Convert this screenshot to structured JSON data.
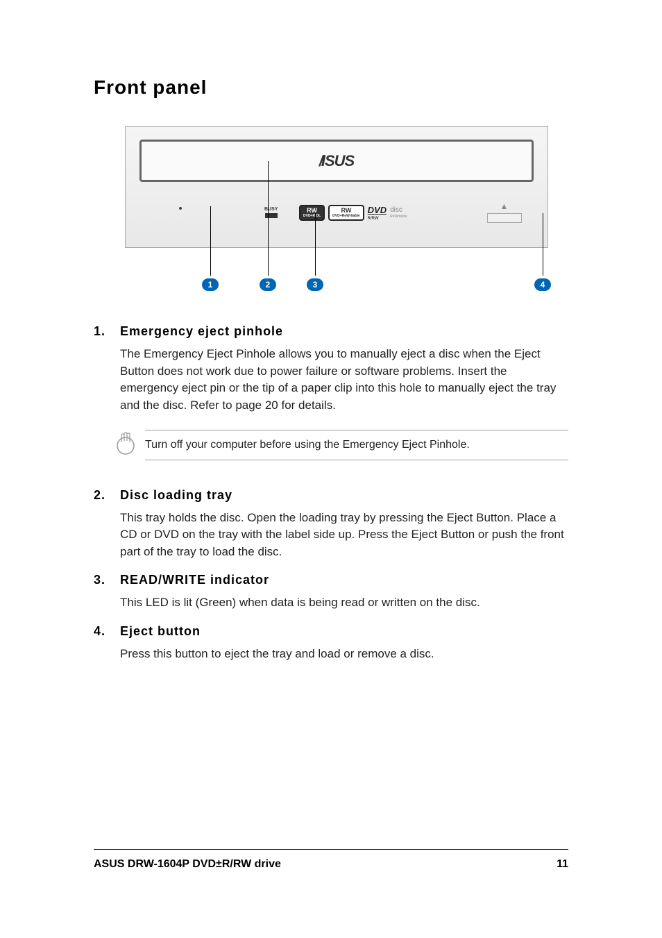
{
  "title": "Front panel",
  "diagram": {
    "brand_logo": "ISUS",
    "busy_label": "BUSY",
    "badges": {
      "rw1": {
        "main": "RW",
        "sub": "DVD+R DL"
      },
      "rw2": {
        "main": "RW",
        "sub": "DVD+ReWritable"
      },
      "dvd": {
        "main": "DVD",
        "sub": "R/RW"
      },
      "disc": {
        "main": "disc",
        "sub": "ReWritable"
      }
    },
    "callouts": [
      "1",
      "2",
      "3",
      "4"
    ]
  },
  "sections": [
    {
      "num": "1.",
      "title": "Emergency eject pinhole",
      "body": "The Emergency Eject Pinhole allows you to manually eject a disc when the Eject Button does not work due to power failure or software problems. Insert the emergency eject pin or the tip of a paper clip into this hole to manually eject the tray and the disc. Refer to page 20 for details."
    },
    {
      "num": "2.",
      "title": "Disc loading tray",
      "body": "This tray holds the disc. Open the loading tray by pressing the Eject Button. Place a CD or DVD on the tray with the label side up. Press the Eject Button or push the front part of the tray to load the disc."
    },
    {
      "num": "3.",
      "title": "READ/WRITE indicator",
      "body": "This LED is lit (Green) when data is being read or written on the disc."
    },
    {
      "num": "4.",
      "title": "Eject button",
      "body": "Press this button to eject the tray and load or remove a disc."
    }
  ],
  "note": "Turn off your computer before using the Emergency Eject Pinhole.",
  "footer": {
    "left": "ASUS DRW-1604P DVD±R/RW drive",
    "page": "11"
  }
}
